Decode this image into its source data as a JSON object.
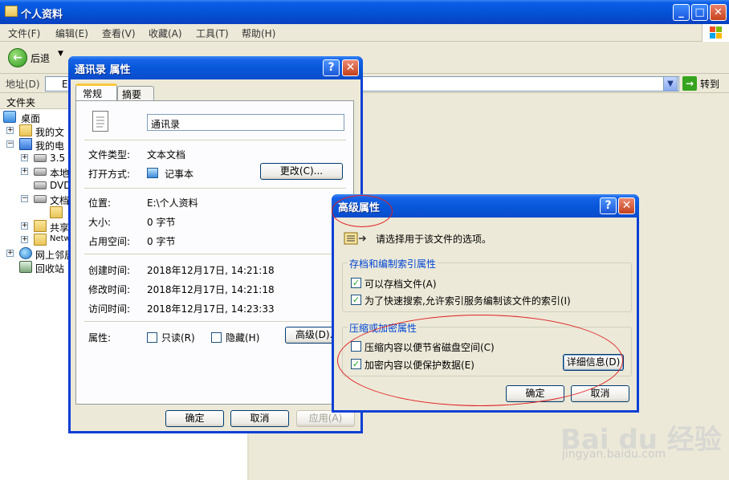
{
  "explorer": {
    "title": "个人资料",
    "menu": [
      "文件(F)",
      "编辑(E)",
      "查看(V)",
      "收藏(A)",
      "工具(T)",
      "帮助(H)"
    ],
    "toolbar": {
      "back": "后退"
    },
    "address": {
      "label": "地址(D)",
      "value": "E",
      "go": "转到"
    },
    "folders_header": "文件夹",
    "tree": [
      {
        "label": "桌面"
      },
      {
        "label": "我的文"
      },
      {
        "label": "我的电"
      },
      {
        "label": "3.5"
      },
      {
        "label": "本地"
      },
      {
        "label": "DVD"
      },
      {
        "label": "文档"
      },
      {
        "label": ""
      },
      {
        "label": "共享"
      },
      {
        "label": "Netw"
      },
      {
        "label": "网上邻居"
      },
      {
        "label": "回收站"
      }
    ]
  },
  "props": {
    "title": "通讯录 属性",
    "tabs": [
      "常规",
      "摘要"
    ],
    "filename": "通讯录",
    "rows": [
      {
        "label": "文件类型:",
        "value": "文本文档"
      },
      {
        "label": "打开方式:",
        "value": "记事本"
      },
      {
        "label": "位置:",
        "value": "E:\\个人资料"
      },
      {
        "label": "大小:",
        "value": "0 字节"
      },
      {
        "label": "占用空间:",
        "value": "0 字节"
      },
      {
        "label": "创建时间:",
        "value": "2018年12月17日, 14:21:18"
      },
      {
        "label": "修改时间:",
        "value": "2018年12月17日, 14:21:18"
      },
      {
        "label": "访问时间:",
        "value": "2018年12月17日, 14:23:33"
      }
    ],
    "change_button": "更改(C)...",
    "attributes_label": "属性:",
    "readonly": "只读(R)",
    "hidden": "隐藏(H)",
    "advanced_button": "高级(D)...",
    "ok": "确定",
    "cancel": "取消",
    "apply": "应用(A)"
  },
  "advanced": {
    "title": "高级属性",
    "prompt": "请选择用于该文件的选项。",
    "group1_title": "存档和编制索引属性",
    "archive": "可以存档文件(A)",
    "index": "为了快速搜索,允许索引服务编制该文件的索引(I)",
    "group2_title": "压缩或加密属性",
    "compress": "压缩内容以便节省磁盘空间(C)",
    "encrypt": "加密内容以便保护数据(E)",
    "details_button": "详细信息(D)",
    "ok": "确定",
    "cancel": "取消",
    "checks": {
      "archive": true,
      "index": true,
      "compress": false,
      "encrypt": true
    }
  },
  "watermark": {
    "logo": "Bai du 经验",
    "url": "jingyan.baidu.com"
  }
}
